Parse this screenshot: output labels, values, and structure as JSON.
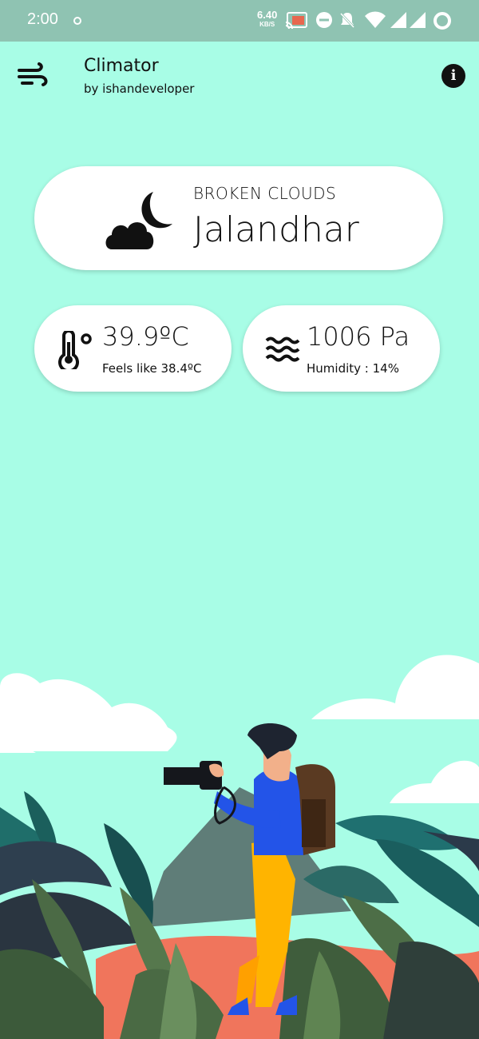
{
  "status_bar": {
    "time": "2:00",
    "speed_value": "6.40",
    "speed_unit": "KB/S"
  },
  "app": {
    "title": "Climator",
    "subtitle": "by ishandeveloper",
    "logo_icon": "wind-icon",
    "info_icon": "info-icon"
  },
  "weather": {
    "condition": "BROKEN CLOUDS",
    "city": "Jalandhar",
    "condition_icon": "cloud-moon-icon"
  },
  "temperature": {
    "value": "39.9ºC",
    "feels_like": "Feels like 38.4ºC",
    "icon": "thermometer-icon"
  },
  "pressure": {
    "value": "1006 Pa",
    "humidity": "Humidity : 14%",
    "icon": "waves-icon"
  },
  "colors": {
    "background": "#a8fde6",
    "status_bar": "#8fc3b2",
    "card": "#ffffff"
  }
}
